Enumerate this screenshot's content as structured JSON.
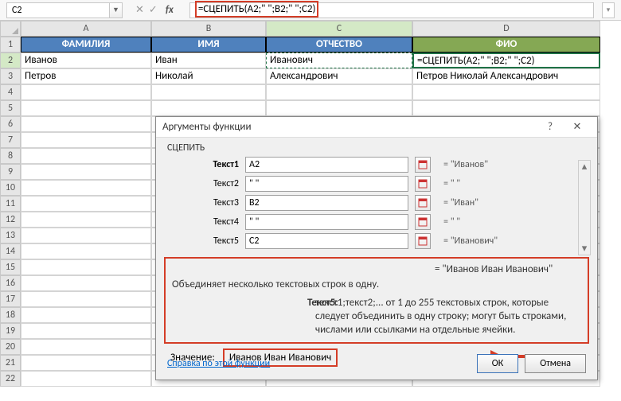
{
  "nameBox": "C2",
  "formula": "=СЦЕПИТЬ(A2;\" \";B2;\" \";C2)",
  "cols": [
    "A",
    "B",
    "C",
    "D"
  ],
  "headers": {
    "A": "ФАМИЛИЯ",
    "B": "ИМЯ",
    "C": "ОТЧЕСТВО",
    "D": "ФИО"
  },
  "rows": {
    "2": {
      "A": "Иванов",
      "B": "Иван",
      "C": "Иванович",
      "D": "=СЦЕПИТЬ(A2;\" \";B2;\" \";C2)"
    },
    "3": {
      "A": "Петров",
      "B": "Николай",
      "C": "Александрович",
      "D": "Петров Николай Александрович"
    }
  },
  "dialog": {
    "title": "Аргументы функции",
    "help": "?",
    "close": "✕",
    "fnName": "СЦЕПИТЬ",
    "args": [
      {
        "label": "Текст1",
        "bold": true,
        "value": "A2",
        "eval": "\"Иванов\""
      },
      {
        "label": "Текст2",
        "bold": false,
        "value": "\" \"",
        "eval": "\" \""
      },
      {
        "label": "Текст3",
        "bold": false,
        "value": "B2",
        "eval": "\"Иван\""
      },
      {
        "label": "Текст4",
        "bold": false,
        "value": "\" \"",
        "eval": "\" \""
      },
      {
        "label": "Текст5",
        "bold": false,
        "value": "C2",
        "eval": "\"Иванович\""
      }
    ],
    "resultPreview": "= \"Иванов Иван Иванович\"",
    "description": "Объединяет несколько текстовых строк в одну.",
    "paramName": "Текст5:",
    "paramDesc": "текст1;текст2;... от 1 до 255 текстовых строк, которые следует объединить в одну строку; могут быть строками, числами или ссылками на отдельные ячейки.",
    "valueLabel": "Значение:",
    "valueResult": "Иванов Иван Иванович",
    "helpLink": "Справка по этой функции",
    "ok": "ОК",
    "cancel": "Отмена"
  }
}
